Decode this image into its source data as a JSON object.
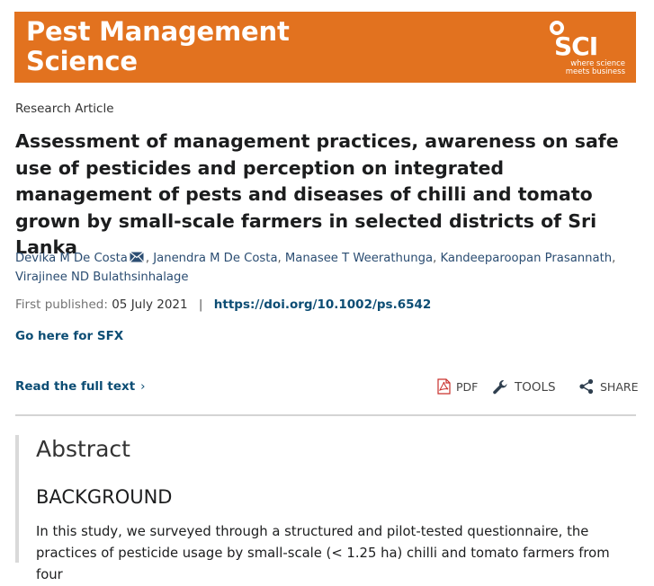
{
  "journal": {
    "title_line1": "Pest Management",
    "title_line2": "Science",
    "logo_text": "SCI",
    "logo_tagline_line1": "where science",
    "logo_tagline_line2": "meets business",
    "brand_color": "#e2721f"
  },
  "article": {
    "type": "Research Article",
    "title": "Assessment of management practices, awareness on safe use of pesticides and perception on integrated management of pests and diseases of chilli and tomato grown by small-scale farmers in selected districts of Sri Lanka",
    "authors": [
      "Devika M De Costa",
      "Janendra M De Costa",
      "Manasee T Weerathunga",
      "Kandeeparoopan Prasannath",
      "Virajinee ND Bulathsinhalage"
    ],
    "first_published_label": "First published:",
    "first_published_date": "05 July 2021",
    "doi": "https://doi.org/10.1002/ps.6542"
  },
  "links": {
    "sfx": "Go here for SFX",
    "read_full_text": "Read the full text"
  },
  "tools": {
    "pdf": "PDF",
    "tools": "TOOLS",
    "share": "SHARE"
  },
  "abstract": {
    "heading": "Abstract",
    "section": "BACKGROUND",
    "text": "In this study, we surveyed through a structured and pilot-tested questionnaire, the practices of pesticide usage by small-scale (< 1.25 ha) chilli and tomato farmers from four"
  }
}
